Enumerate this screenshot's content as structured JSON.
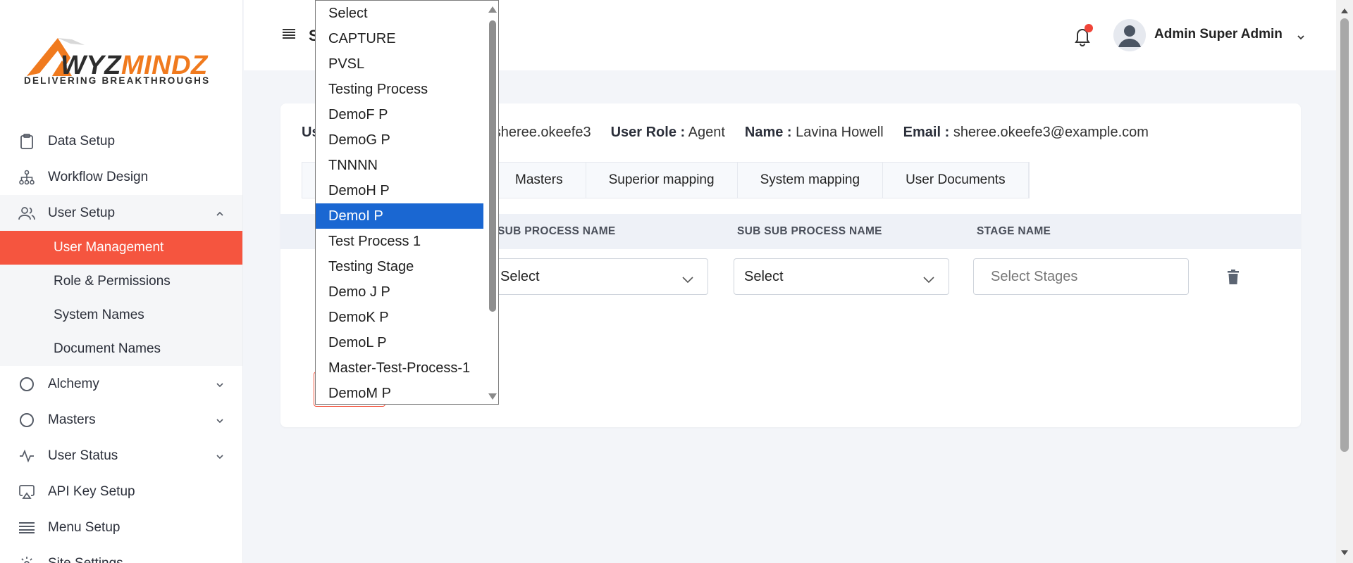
{
  "brand": {
    "name_part1": "WYZ",
    "name_part2": "MINDZ",
    "tagline": "DELIVERING  BREAKTHROUGHS",
    "accent": "#f07a1e"
  },
  "sidebar": {
    "items": [
      {
        "label": "Data Setup",
        "icon": "clipboard-icon"
      },
      {
        "label": "Workflow Design",
        "icon": "hierarchy-icon"
      },
      {
        "label": "User Setup",
        "icon": "users-icon",
        "expanded": true,
        "children": [
          {
            "label": "User Management",
            "active": true
          },
          {
            "label": "Role & Permissions"
          },
          {
            "label": "System Names"
          },
          {
            "label": "Document Names"
          }
        ]
      },
      {
        "label": "Alchemy",
        "icon": "circle-icon"
      },
      {
        "label": "Masters",
        "icon": "circle-icon"
      },
      {
        "label": "User Status",
        "icon": "activity-icon"
      },
      {
        "label": "API Key Setup",
        "icon": "airplay-icon"
      },
      {
        "label": "Menu Setup",
        "icon": "menu-icon"
      },
      {
        "label": "Site Settings",
        "icon": "gear-icon"
      }
    ],
    "active_color": "#f5553f"
  },
  "topbar": {
    "title": "S",
    "user_name": "Admin Super Admin",
    "notification_color": "#f04438"
  },
  "user_info": {
    "username_label": "Us",
    "username_value": ": sheree.okeefe3",
    "role_label": "User Role :",
    "role_value": "Agent",
    "name_label": "Name :",
    "name_value": "Lavina Howell",
    "email_label": "Email :",
    "email_value": "sheree.okeefe3@example.com"
  },
  "tabs": [
    "Masters",
    "Superior mapping",
    "System mapping",
    "User Documents"
  ],
  "table": {
    "headers": [
      "SUB PROCESS NAME",
      "SUB SUB PROCESS NAME",
      "STAGE NAME"
    ],
    "row": {
      "sub_process": "Select",
      "sub_sub_process": "Select",
      "stages_placeholder": "Select Stages"
    }
  },
  "dropdown": {
    "options": [
      "Select",
      "CAPTURE",
      "PVSL",
      "Testing Process",
      "DemoF P",
      "DemoG P",
      "TNNNN",
      "DemoH P",
      "DemoI P",
      "Test Process 1",
      "Testing Stage",
      "Demo J P",
      "DemoK P",
      "DemoL P",
      "Master-Test-Process-1",
      "DemoM P"
    ],
    "highlighted": "DemoI P",
    "highlight_color": "#1a67d2"
  }
}
